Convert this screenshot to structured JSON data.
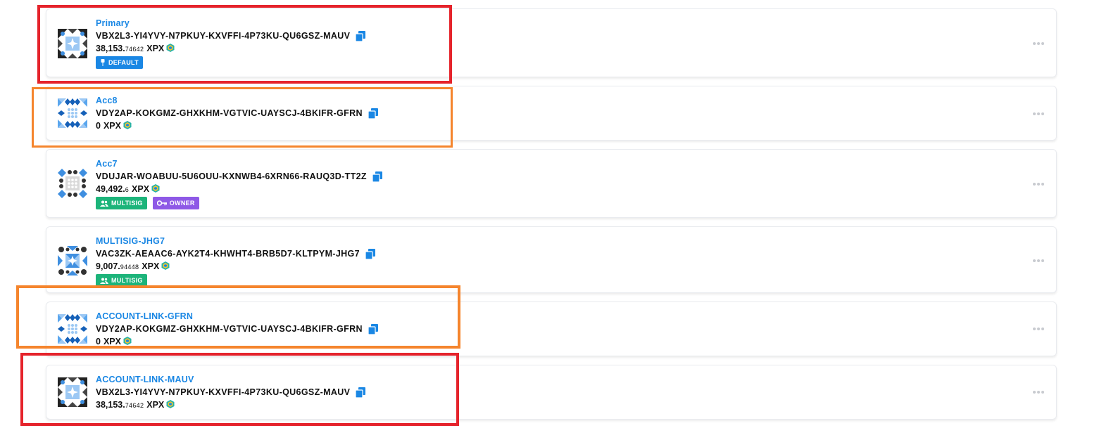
{
  "accounts": [
    {
      "name": "Primary",
      "address": "VBX2L3-YI4YVY-N7PKUY-KXVFFI-4P73KU-QU6GSZ-MAUV",
      "balance_whole": "38,153.",
      "balance_fraction": "74642",
      "unit": "XPX",
      "badges": [
        {
          "label": "DEFAULT",
          "icon": "pin-icon",
          "color": "#1a87e4"
        }
      ]
    },
    {
      "name": "Acc8",
      "address": "VDY2AP-KOKGMZ-GHXKHM-VGTVIC-UAYSCJ-4BKIFR-GFRN",
      "balance_whole": "0",
      "balance_fraction": "",
      "unit": "XPX",
      "badges": []
    },
    {
      "name": "Acc7",
      "address": "VDUJAR-WOABUU-5U6OUU-KXNWB4-6XRN66-RAUQ3D-TT2Z",
      "balance_whole": "49,492.",
      "balance_fraction": "6",
      "unit": "XPX",
      "badges": [
        {
          "label": "MULTISIG",
          "icon": "users-icon",
          "color": "#1cb47a"
        },
        {
          "label": "OWNER",
          "icon": "key-icon",
          "color": "#8e59e6"
        }
      ]
    },
    {
      "name": "MULTISIG-JHG7",
      "address": "VAC3ZK-AEAAC6-AYK2T4-KHWHT4-BRB5D7-KLTPYM-JHG7",
      "balance_whole": "9,007.",
      "balance_fraction": "94448",
      "unit": "XPX",
      "badges": [
        {
          "label": "MULTISIG",
          "icon": "users-icon",
          "color": "#1cb47a"
        }
      ]
    },
    {
      "name": "ACCOUNT-LINK-GFRN",
      "address": "VDY2AP-KOKGMZ-GHXKHM-VGTVIC-UAYSCJ-4BKIFR-GFRN",
      "balance_whole": "0",
      "balance_fraction": "",
      "unit": "XPX",
      "badges": []
    },
    {
      "name": "ACCOUNT-LINK-MAUV",
      "address": "VBX2L3-YI4YVY-N7PKUY-KXVFFI-4P73KU-QU6GSZ-MAUV",
      "balance_whole": "38,153.",
      "balance_fraction": "74642",
      "unit": "XPX",
      "badges": []
    }
  ],
  "highlight_colors": {
    "red": "#e5232b",
    "orange": "#f5852d"
  }
}
